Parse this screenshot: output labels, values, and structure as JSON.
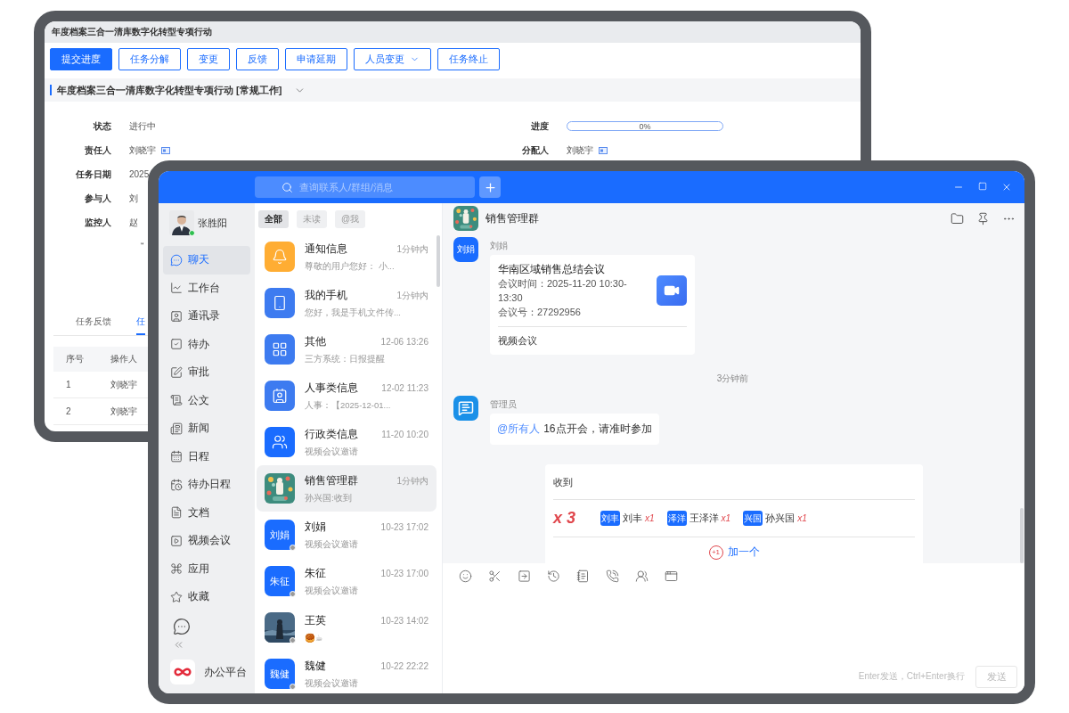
{
  "back_window": {
    "title": "年度档案三合一清库数字化转型专项行动",
    "toolbar": [
      {
        "label": "提交进度",
        "kind": "primary"
      },
      {
        "label": "任务分解",
        "kind": "outline"
      },
      {
        "label": "变更",
        "kind": "outline"
      },
      {
        "label": "反馈",
        "kind": "outline"
      },
      {
        "label": "申请延期",
        "kind": "outline"
      },
      {
        "label": "人员变更",
        "kind": "dropdown"
      },
      {
        "label": "任务终止",
        "kind": "outline"
      }
    ],
    "section_title": "年度档案三合一清库数字化转型专项行动 [常规工作]",
    "fields_left": [
      {
        "label": "状态",
        "value": "进行中",
        "kind": "text"
      },
      {
        "label": "责任人",
        "value": "刘晓宇",
        "kind": "person"
      },
      {
        "label": "任务日期",
        "value": "2025",
        "kind": "text"
      },
      {
        "label": "参与人",
        "value": "刘",
        "kind": "text"
      },
      {
        "label": "监控人",
        "value": "赵",
        "kind": "text"
      }
    ],
    "note": "“",
    "fields_right": [
      {
        "label": "进度",
        "kind": "progress",
        "level": 0,
        "reading": "0%"
      },
      {
        "label": "分配人",
        "value": "刘晓宇",
        "kind": "person"
      }
    ],
    "tabs": [
      {
        "label": "任务反馈",
        "selected": false
      },
      {
        "label": "任",
        "selected": true
      }
    ],
    "table": {
      "columns": [
        "序号",
        "操作人"
      ],
      "rows": [
        [
          "1",
          "刘晓宇"
        ],
        [
          "2",
          "刘晓宇"
        ]
      ]
    }
  },
  "messenger": {
    "search": {
      "placeholder": "查询联系人/群组/消息"
    },
    "user": {
      "name": "张胜阳",
      "online": true
    },
    "nav": [
      {
        "label": "聊天",
        "selected": true
      },
      {
        "label": "工作台",
        "selected": false
      },
      {
        "label": "通讯录",
        "selected": false
      },
      {
        "label": "待办",
        "selected": false
      },
      {
        "label": "审批",
        "selected": false
      },
      {
        "label": "公文",
        "selected": false
      },
      {
        "label": "新闻",
        "selected": false
      },
      {
        "label": "日程",
        "selected": false
      },
      {
        "label": "待办日程",
        "selected": false
      },
      {
        "label": "文档",
        "selected": false
      },
      {
        "label": "视频会议",
        "selected": false
      },
      {
        "label": "应用",
        "selected": false
      },
      {
        "label": "收藏",
        "selected": false
      }
    ],
    "platform": "办公平台",
    "filters": [
      {
        "label": "全部",
        "selected": true
      },
      {
        "label": "未读",
        "selected": false
      },
      {
        "label": "@我",
        "selected": false
      }
    ],
    "chats": [
      {
        "name": "通知信息",
        "time": "1分钟内",
        "preview": "尊敬的用户您好：  小...",
        "kind": "icon",
        "color": "#ffad33",
        "selected": false
      },
      {
        "name": "我的手机",
        "time": "1分钟内",
        "preview": "您好，我是手机文件传...",
        "kind": "icon",
        "color": "#3d7bf0",
        "selected": false
      },
      {
        "name": "其他",
        "time": "12-06 13:26",
        "preview": "三方系统：日报提醒",
        "kind": "icon",
        "color": "#3d7bf0",
        "selected": false
      },
      {
        "name": "人事类信息",
        "time": "12-02 11:23",
        "preview": "人事：【2025-12-01...",
        "kind": "icon",
        "color": "#3d7bf0",
        "selected": false
      },
      {
        "name": "行政类信息",
        "time": "11-20 10:20",
        "preview": "视频会议邀请",
        "kind": "icon",
        "color": "#1a6cff",
        "selected": false
      },
      {
        "name": "销售管理群",
        "time": "1分钟内",
        "preview": "孙兴国:收到",
        "kind": "picture",
        "selected": true
      },
      {
        "name": "刘娟",
        "time": "10-23 17:02",
        "preview": "视频会议邀请",
        "kind": "text",
        "avatar_text": "刘娟",
        "color": "#1a6cff",
        "online": false,
        "selected": false
      },
      {
        "name": "朱征",
        "time": "10-23 17:00",
        "preview": "视频会议邀请",
        "kind": "text",
        "avatar_text": "朱征",
        "color": "#1a6cff",
        "online": false,
        "selected": false
      },
      {
        "name": "王英",
        "time": "10-23 14:02",
        "preview": "🥮☕",
        "kind": "picture",
        "online": false,
        "selected": false
      },
      {
        "name": "魏健",
        "time": "10-22 22:22",
        "preview": "视频会议邀请",
        "kind": "text",
        "avatar_text": "魏健",
        "color": "#1a6cff",
        "online": false,
        "selected": false
      }
    ],
    "conversation": {
      "title": "销售管理群",
      "messages": [
        {
          "kind": "meeting",
          "sender": "刘娟",
          "avatar_text": "刘娟",
          "title": "华南区域销售总结会议",
          "time": "会议时间：2025-11-20 10:30-13:30",
          "number": "会议号：27292956",
          "footer": "视频会议"
        },
        {
          "kind": "time",
          "text": "3分钟前"
        },
        {
          "kind": "text",
          "sender": "管理员",
          "mention": "@所有人",
          "text": "16点开会，请准时参加"
        },
        {
          "kind": "relay",
          "text": "收到",
          "count": "x 3",
          "people": [
            {
              "tag": "刘丰",
              "name": "刘丰",
              "count": "x1"
            },
            {
              "tag": "泽洋",
              "name": "王泽洋",
              "count": "x1"
            },
            {
              "tag": "兴国",
              "name": "孙兴国",
              "count": "x1"
            }
          ],
          "plus": "+1",
          "add": "加一个"
        }
      ]
    },
    "composer": {
      "hint": "Enter发送，Ctrl+Enter换行",
      "send": "发送",
      "disabled": true
    }
  }
}
